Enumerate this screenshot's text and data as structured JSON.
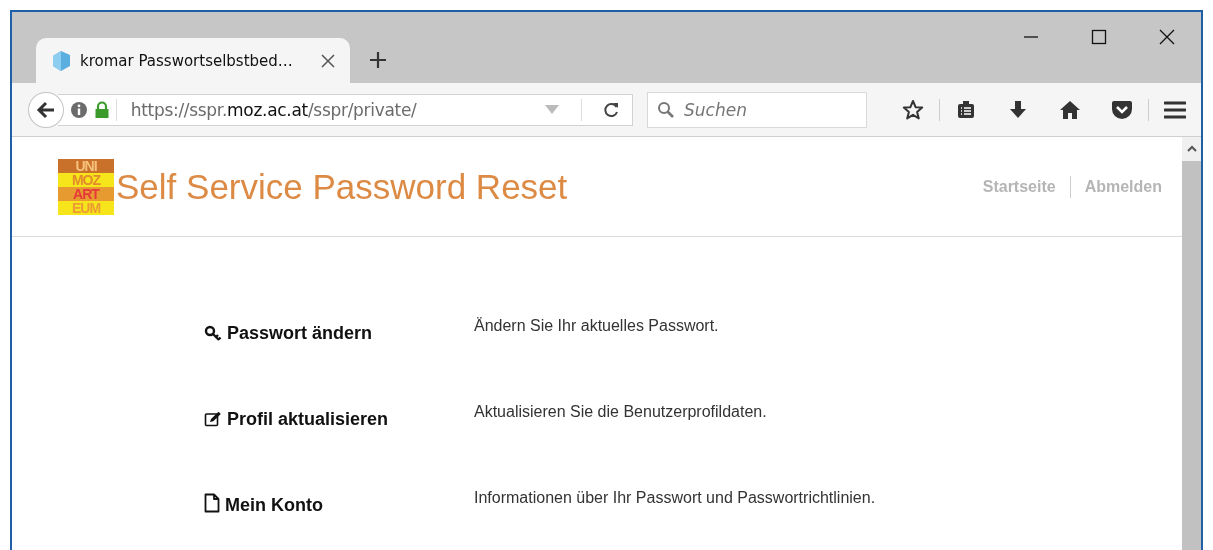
{
  "tab": {
    "title": "kromar Passwortselbstbed…",
    "selected": true
  },
  "address_bar": {
    "url_prefix": "https://sspr.",
    "url_domain": "moz.ac.at",
    "url_path": "/sspr/private/"
  },
  "search": {
    "placeholder": "Suchen"
  },
  "header": {
    "logo_lines": [
      "UNI",
      "MOZ",
      "ART",
      "EUM"
    ],
    "title": "Self Service Password Reset",
    "nav": [
      "Startseite",
      "Abmelden"
    ]
  },
  "menu": [
    {
      "kind": "key",
      "label": "Passwort ändern",
      "description": "Ändern Sie Ihr aktuelles Passwort."
    },
    {
      "kind": "edit",
      "label": "Profil aktualisieren",
      "description": "Aktualisieren Sie die Benutzerprofildaten."
    },
    {
      "kind": "file",
      "label": "Mein Konto",
      "description": "Informationen über Ihr Passwort und Passwortrichtlinien."
    }
  ]
}
